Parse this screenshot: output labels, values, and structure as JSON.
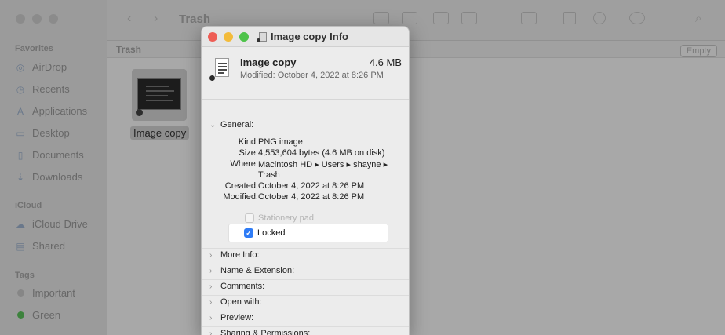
{
  "finder": {
    "title": "Trash",
    "path_label": "Trash",
    "empty_button": "Empty",
    "favorites_label": "Favorites",
    "favorites": [
      {
        "label": "AirDrop",
        "icon": "airdrop-icon"
      },
      {
        "label": "Recents",
        "icon": "clock-icon"
      },
      {
        "label": "Applications",
        "icon": "applications-icon"
      },
      {
        "label": "Desktop",
        "icon": "desktop-icon"
      },
      {
        "label": "Documents",
        "icon": "document-icon"
      },
      {
        "label": "Downloads",
        "icon": "download-icon"
      }
    ],
    "icloud_label": "iCloud",
    "icloud": [
      {
        "label": "iCloud Drive",
        "icon": "cloud-icon"
      },
      {
        "label": "Shared",
        "icon": "shared-folder-icon"
      }
    ],
    "tags_label": "Tags",
    "tags": [
      {
        "label": "Important",
        "color": "#c8c8c8"
      },
      {
        "label": "Green",
        "color": "#5cc25c"
      }
    ],
    "file_label": "Image copy"
  },
  "info": {
    "window_title": "Image copy Info",
    "name": "Image copy",
    "size": "4.6 MB",
    "modified_line": "Modified: October 4, 2022 at 8:26 PM",
    "general_label": "General:",
    "rows": [
      {
        "key": "Kind:",
        "value": "PNG image"
      },
      {
        "key": "Size:",
        "value": "4,553,604 bytes (4.6 MB on disk)"
      },
      {
        "key": "Where:",
        "value": "Macintosh HD ▸ Users ▸ shayne ▸"
      },
      {
        "key": "",
        "value": "Trash"
      },
      {
        "key": "Created:",
        "value": "October 4, 2022 at 8:26 PM"
      },
      {
        "key": "Modified:",
        "value": "October 4, 2022 at 8:26 PM"
      }
    ],
    "stationery_label": "Stationery pad",
    "locked_label": "Locked",
    "locked_checked": true,
    "sections": [
      "More Info:",
      "Name & Extension:",
      "Comments:",
      "Open with:",
      "Preview:",
      "Sharing & Permissions:"
    ]
  }
}
